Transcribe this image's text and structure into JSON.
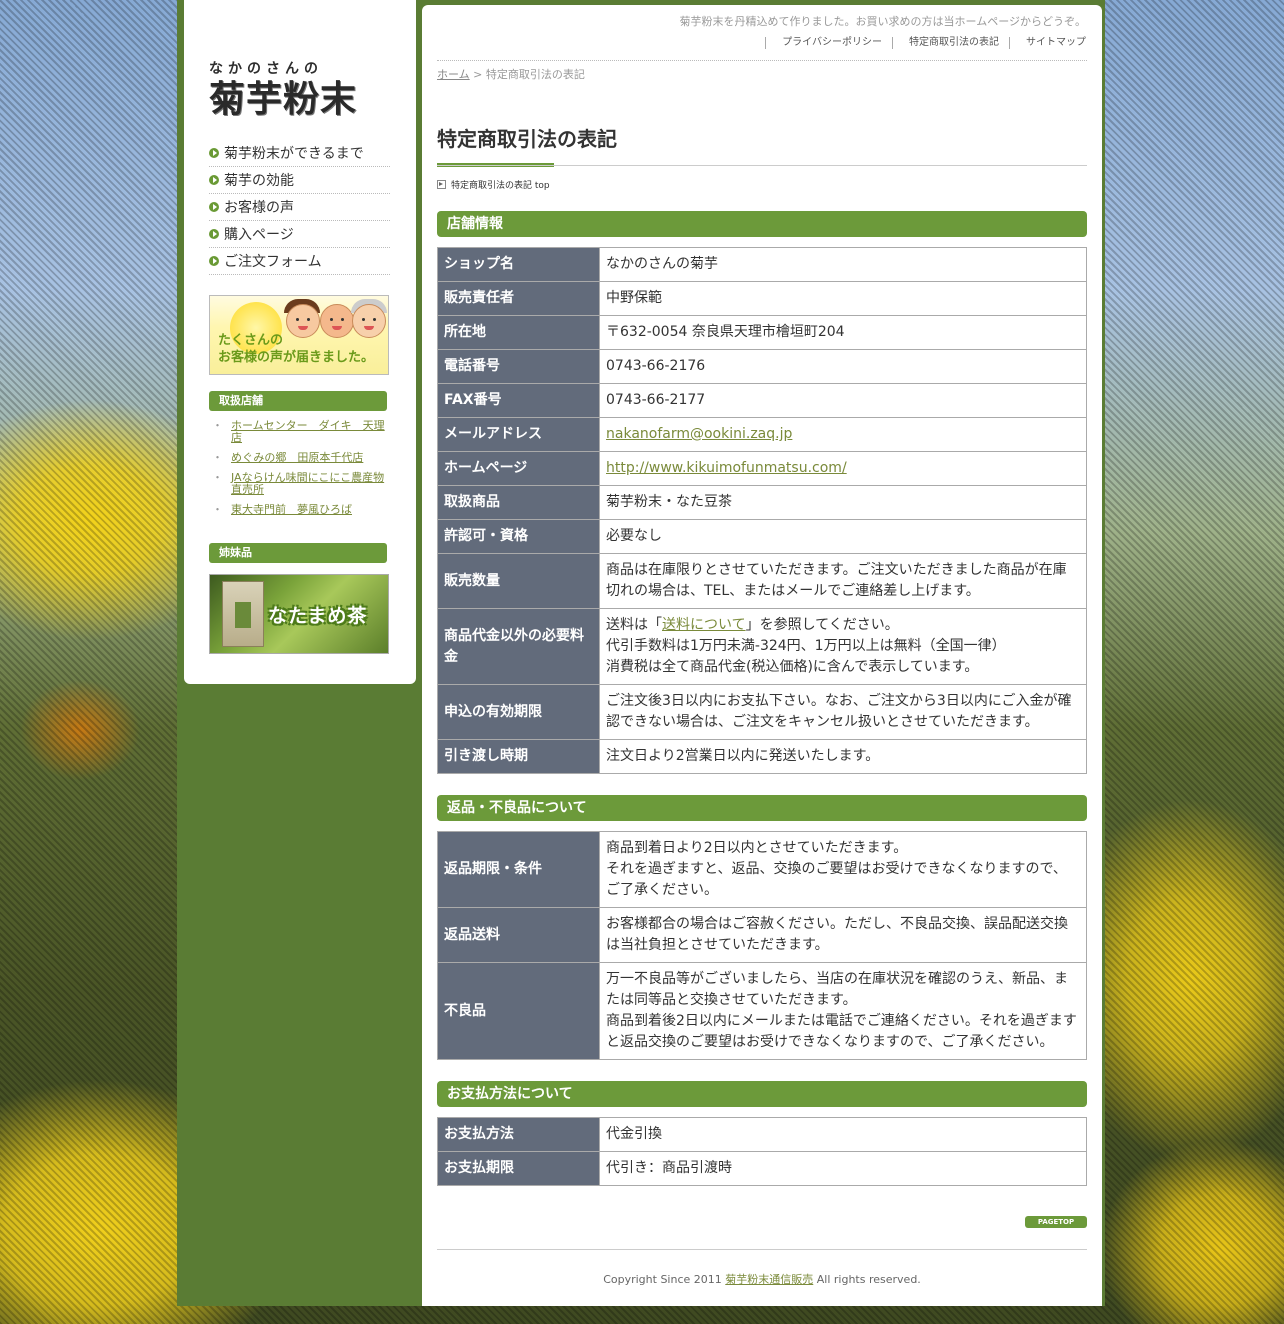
{
  "header": {
    "tagline": "菊芋粉末を丹精込めて作りました。お買い求めの方は当ホームページからどうぞ。",
    "links": [
      "プライバシーポリシー",
      "特定商取引法の表記",
      "サイトマップ"
    ]
  },
  "logo": {
    "top": "なかのさんの",
    "main": "菊芋粉末"
  },
  "nav": [
    "菊芋粉末ができるまで",
    "菊芋の効能",
    "お客様の声",
    "購入ページ",
    "ご注文フォーム"
  ],
  "voice_banner": {
    "line1": "たくさんの",
    "line2": "お客様の声が届きました。"
  },
  "shops": {
    "heading": "取扱店舗",
    "items": [
      "ホームセンター　ダイキ　天理店",
      "めぐみの郷　田原本千代店",
      "JAならけん味間にこにこ農産物直売所",
      "東大寺門前　夢風ひろば"
    ]
  },
  "sister": {
    "heading": "姉妹品",
    "banner": "なたまめ茶"
  },
  "breadcrumb": {
    "home": "ホーム",
    "sep": " > ",
    "current": "特定商取引法の表記"
  },
  "page_title": "特定商取引法の表記",
  "anchor": "特定商取引法の表記 top",
  "store": {
    "heading": "店舗情報",
    "rows": {
      "shop": {
        "th": "ショップ名",
        "td": "なかのさんの菊芋"
      },
      "manager": {
        "th": "販売責任者",
        "td": "中野保範"
      },
      "address": {
        "th": "所在地",
        "td": "〒632-0054 奈良県天理市檜垣町204"
      },
      "tel": {
        "th": "電話番号",
        "td": "0743-66-2176"
      },
      "fax": {
        "th": "FAX番号",
        "td": "0743-66-2177"
      },
      "email": {
        "th": "メールアドレス",
        "td": "nakanofarm@ookini.zaq.jp"
      },
      "homepage": {
        "th": "ホームページ",
        "td": "http://www.kikuimofunmatsu.com/"
      },
      "products": {
        "th": "取扱商品",
        "td": "菊芋粉末・なた豆茶"
      },
      "license": {
        "th": "許認可・資格",
        "td": "必要なし"
      },
      "quantity": {
        "th": "販売数量",
        "td": "商品は在庫限りとさせていただきます。ご注文いただきました商品が在庫切れの場合は、TEL、またはメールでご連絡差し上げます。"
      },
      "fees": {
        "th": "商品代金以外の必要料金",
        "line1_pre": "送料は「",
        "line1_link": "送料について",
        "line1_post": "」を参照してください。",
        "line2": "代引手数料は1万円未満-324円、1万円以上は無料（全国一律）",
        "line3": "消費税は全て商品代金(税込価格)に含んで表示しています。"
      },
      "validity": {
        "th": "申込の有効期限",
        "td": "ご注文後3日以内にお支払下さい。なお、ご注文から3日以内にご入金が確認できない場合は、ご注文をキャンセル扱いとさせていただきます。"
      },
      "delivery": {
        "th": "引き渡し時期",
        "td": "注文日より2営業日以内に発送いたします。"
      }
    }
  },
  "returns": {
    "heading": "返品・不良品について",
    "rows": {
      "period": {
        "th": "返品期限・条件",
        "td": "商品到着日より2日以内とさせていただきます。\nそれを過ぎますと、返品、交換のご要望はお受けできなくなりますので、ご了承ください。"
      },
      "shipping": {
        "th": "返品送料",
        "td": "お客様都合の場合はご容赦ください。ただし、不良品交換、誤品配送交換は当社負担とさせていただきます。"
      },
      "defect": {
        "th": "不良品",
        "td": "万一不良品等がございましたら、当店の在庫状況を確認のうえ、新品、または同等品と交換させていただきます。\n商品到着後2日以内にメールまたは電話でご連絡ください。それを過ぎますと返品交換のご要望はお受けできなくなりますので、ご了承ください。"
      }
    }
  },
  "payment": {
    "heading": "お支払方法について",
    "rows": {
      "method": {
        "th": "お支払方法",
        "td": "代金引換"
      },
      "deadline": {
        "th": "お支払期限",
        "td": "代引き：商品引渡時"
      }
    }
  },
  "pagetop": "PAGETOP",
  "footer": {
    "pre": "Copyright Since 2011 ",
    "link": "菊芋粉末通信販売",
    "post": " All rights reserved."
  },
  "colors": {
    "accent": "#6c9a3a",
    "th_bg": "#626b7b",
    "frame": "#5a7c34"
  }
}
